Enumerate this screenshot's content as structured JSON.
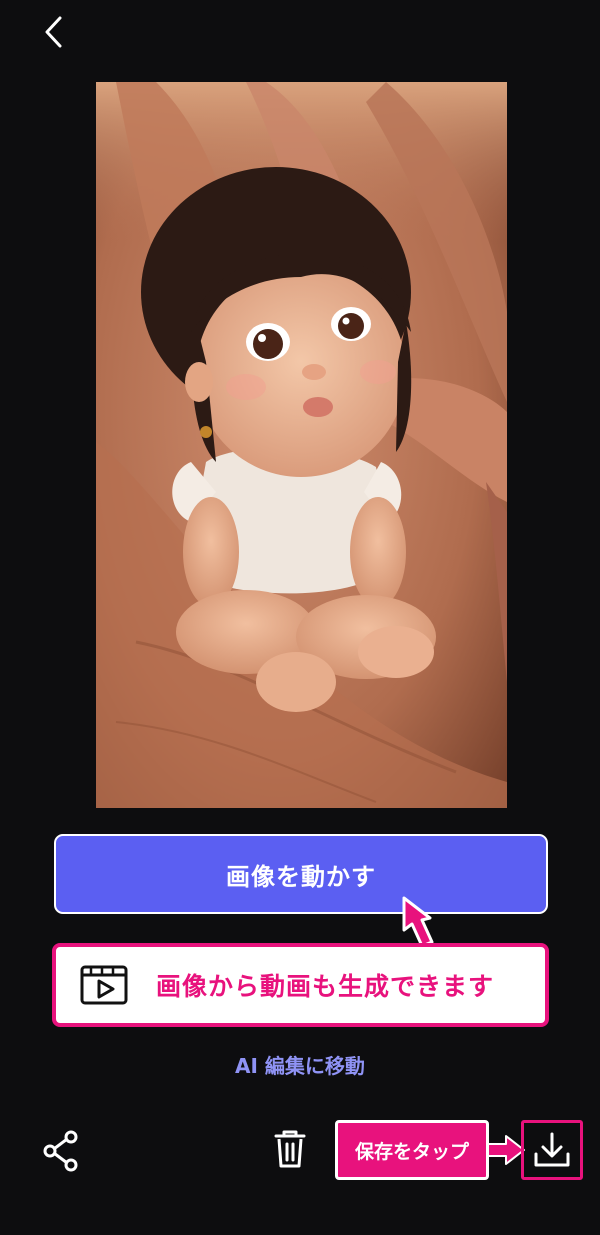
{
  "header": {
    "back_icon": "chevron-left-icon"
  },
  "preview": {
    "image": "generated-image",
    "subject": "tiny baby sitting on a hand"
  },
  "actions": {
    "animate_label": "画像を動かす",
    "ai_edit_link": "AI 編集に移動"
  },
  "annotations": {
    "callout_text": "画像から動画も生成できます",
    "callout_icon": "video-play-icon",
    "save_tip": "保存をタップ",
    "accent_color": "#e8127d"
  },
  "toolbar": {
    "share_icon": "share-icon",
    "delete_icon": "trash-icon",
    "download_icon": "download-icon"
  },
  "colors": {
    "background": "#0d0d0f",
    "primary_button": "#5b5ff2",
    "link": "#8f93f5",
    "highlight": "#e8127d"
  }
}
